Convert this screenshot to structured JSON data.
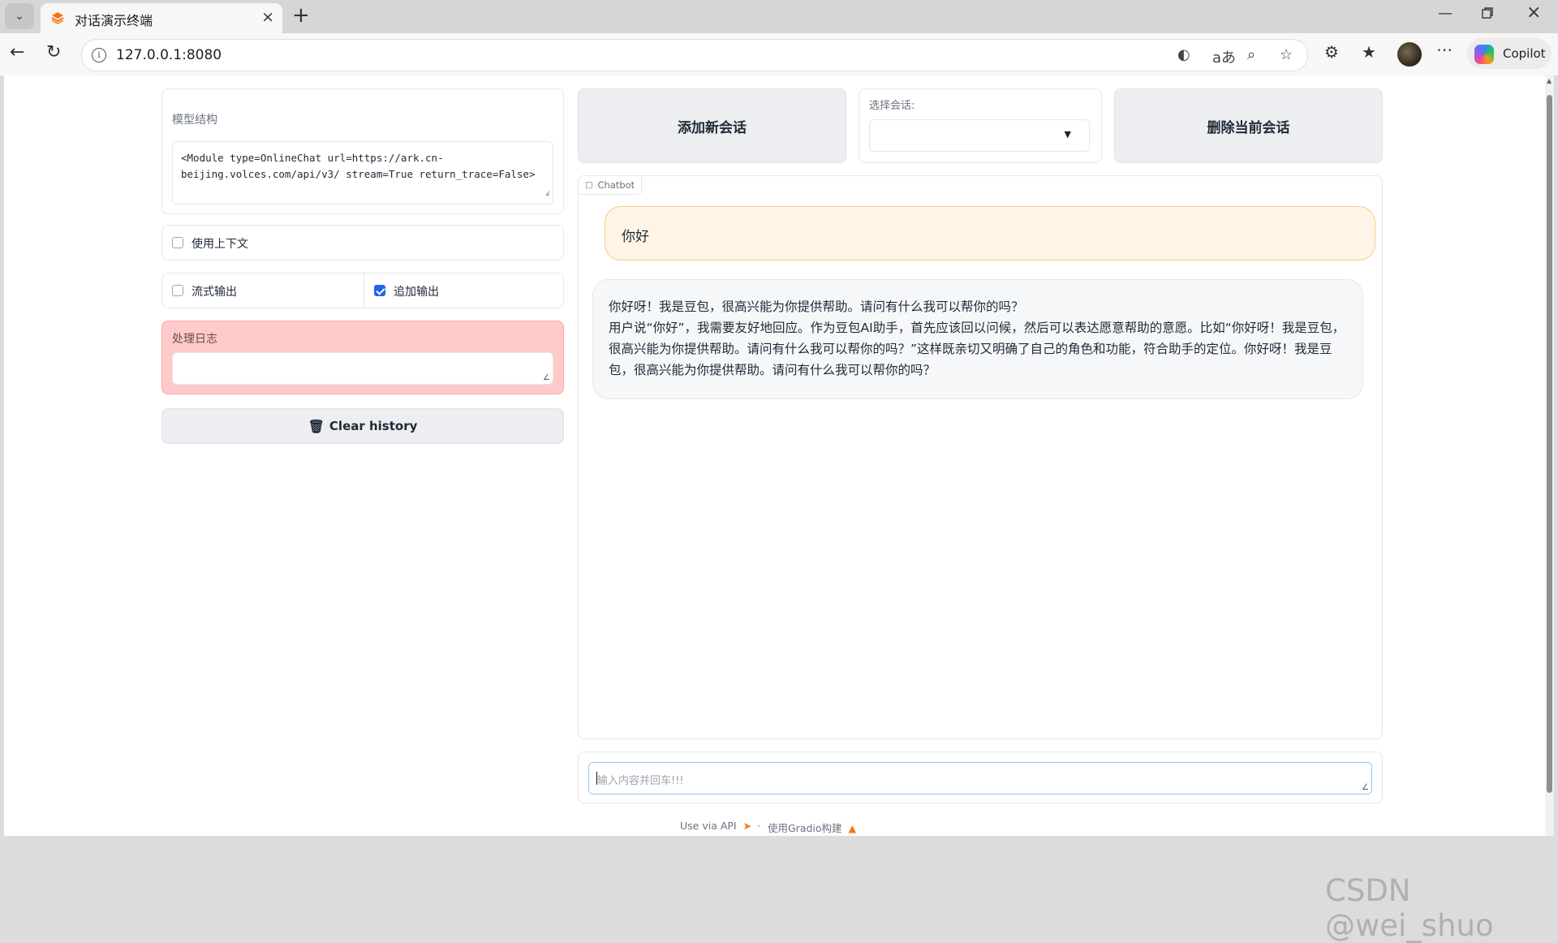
{
  "browser": {
    "tab_title": "对话演示终端",
    "url": "127.0.0.1:8080",
    "copilot_label": "Copilot"
  },
  "left": {
    "model_structure_label": "模型结构",
    "model_structure_value": "<Module type=OnlineChat url=https://ark.cn-beijing.volces.com/api/v3/ stream=True return_trace=False>",
    "use_context_label": "使用上下文",
    "use_context_checked": false,
    "stream_output_label": "流式输出",
    "stream_output_checked": false,
    "append_output_label": "追加输出",
    "append_output_checked": true,
    "log_label": "处理日志",
    "log_value": "",
    "clear_history_label": "Clear history"
  },
  "right": {
    "add_session_label": "添加新会话",
    "select_session_label": "选择会话:",
    "select_session_value": "",
    "delete_session_label": "删除当前会话",
    "chatbot_label": "Chatbot",
    "messages": [
      {
        "role": "user",
        "text": "你好"
      },
      {
        "role": "assistant",
        "lines": [
          "你好呀！我是豆包，很高兴能为你提供帮助。请问有什么我可以帮你的吗？",
          "用户说“你好”，我需要友好地回应。作为豆包AI助手，首先应该回以问候，然后可以表达愿意帮助的意愿。比如“你好呀！我是豆包，很高兴能为你提供帮助。请问有什么我可以帮你的吗？”这样既亲切又明确了自己的角色和功能，符合助手的定位。你好呀！我是豆包，很高兴能为你提供帮助。请问有什么我可以帮你的吗？"
        ]
      }
    ],
    "input_placeholder": "输入内容并回车!!!"
  },
  "footer": {
    "api_label": "Use via API",
    "separator": "·",
    "built_with": "使用Gradio构建"
  },
  "watermark": "CSDN @wei_shuo",
  "colors": {
    "accent_blue": "#2563eb",
    "user_bubble": "#fff4e6",
    "user_bubble_border": "#f7c98a",
    "log_panel": "#fecaca"
  }
}
